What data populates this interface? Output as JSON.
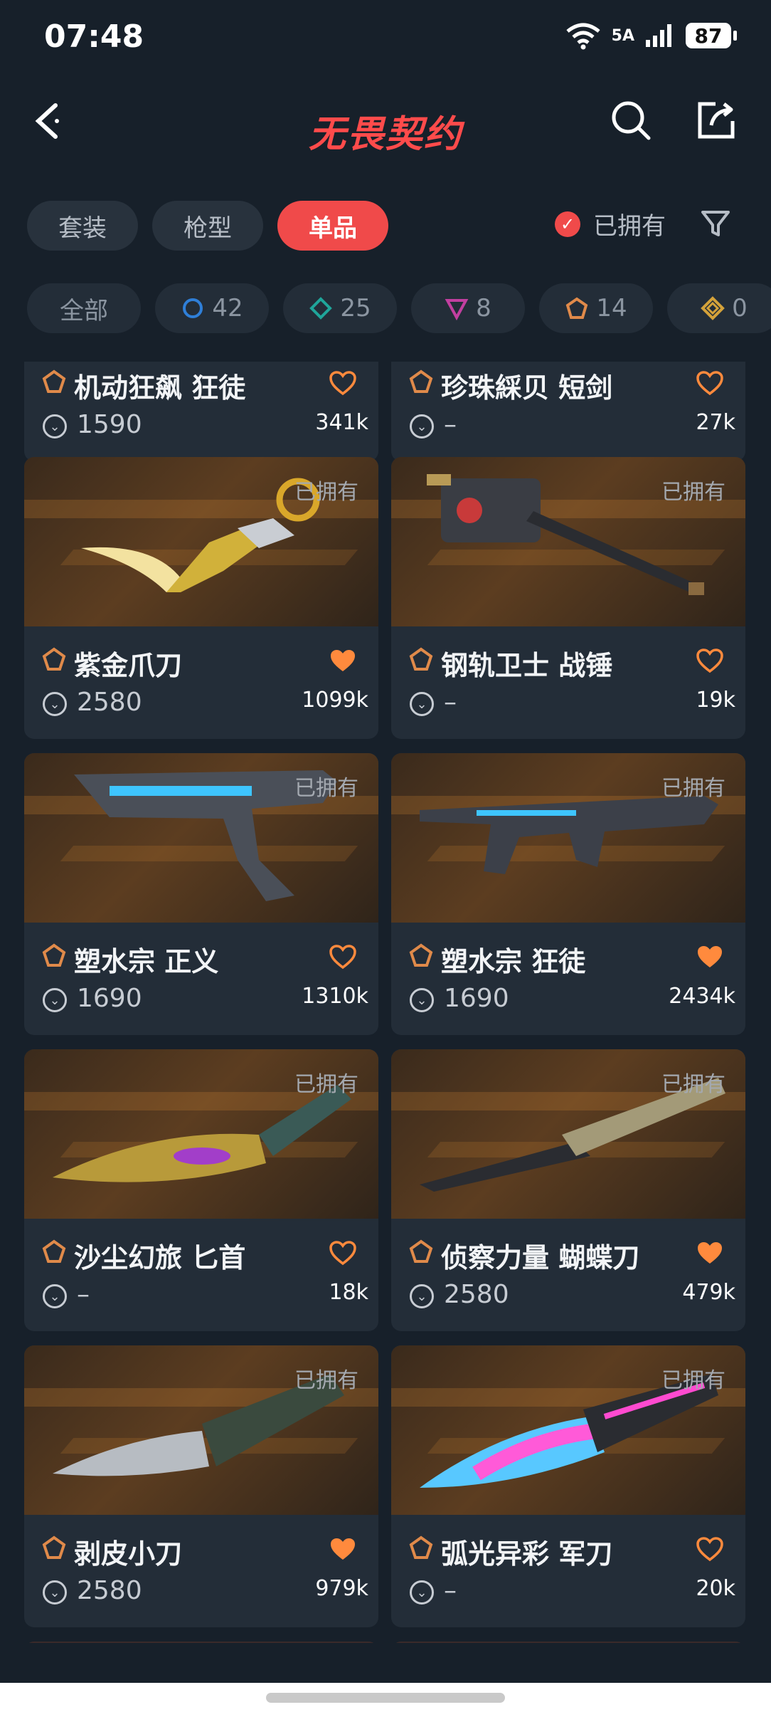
{
  "status": {
    "time": "07:48",
    "network": "5A",
    "wifi_label": "6",
    "battery": "87"
  },
  "header": {
    "title": "无畏契约"
  },
  "tabs": [
    {
      "label": "套装"
    },
    {
      "label": "枪型"
    },
    {
      "label": "单品"
    }
  ],
  "owned_filter": {
    "label": "已拥有"
  },
  "tiers": [
    {
      "label": "全部"
    },
    {
      "label": "42",
      "color": "#2f7fd8"
    },
    {
      "label": "25",
      "color": "#1fa59a"
    },
    {
      "label": "8",
      "color": "#c23fa0"
    },
    {
      "label": "14",
      "color": "#e08a4a"
    },
    {
      "label": "0",
      "color": "#d4a23a"
    }
  ],
  "items": [
    {
      "name": "机动狂飙 狂徒",
      "price": "1590",
      "likes": "341k",
      "owned": "",
      "liked": false
    },
    {
      "name": "珍珠綵贝 短剑",
      "price": "–",
      "likes": "27k",
      "owned": "",
      "liked": false
    },
    {
      "name": "紫金爪刀",
      "price": "2580",
      "likes": "1099k",
      "owned": "已拥有",
      "liked": true
    },
    {
      "name": "钢轨卫士 战锤",
      "price": "–",
      "likes": "19k",
      "owned": "已拥有",
      "liked": false
    },
    {
      "name": "塑水宗 正义",
      "price": "1690",
      "likes": "1310k",
      "owned": "已拥有",
      "liked": false
    },
    {
      "name": "塑水宗 狂徒",
      "price": "1690",
      "likes": "2434k",
      "owned": "已拥有",
      "liked": true
    },
    {
      "name": "沙尘幻旅 匕首",
      "price": "–",
      "likes": "18k",
      "owned": "已拥有",
      "liked": false
    },
    {
      "name": "侦察力量 蝴蝶刀",
      "price": "2580",
      "likes": "479k",
      "owned": "已拥有",
      "liked": true
    },
    {
      "name": "剥皮小刀",
      "price": "2580",
      "likes": "979k",
      "owned": "已拥有",
      "liked": true
    },
    {
      "name": "弧光异彩 军刀",
      "price": "–",
      "likes": "20k",
      "owned": "已拥有",
      "liked": false
    }
  ],
  "colors": {
    "accent": "#f04a4a",
    "heart": "#ff8a3d"
  }
}
